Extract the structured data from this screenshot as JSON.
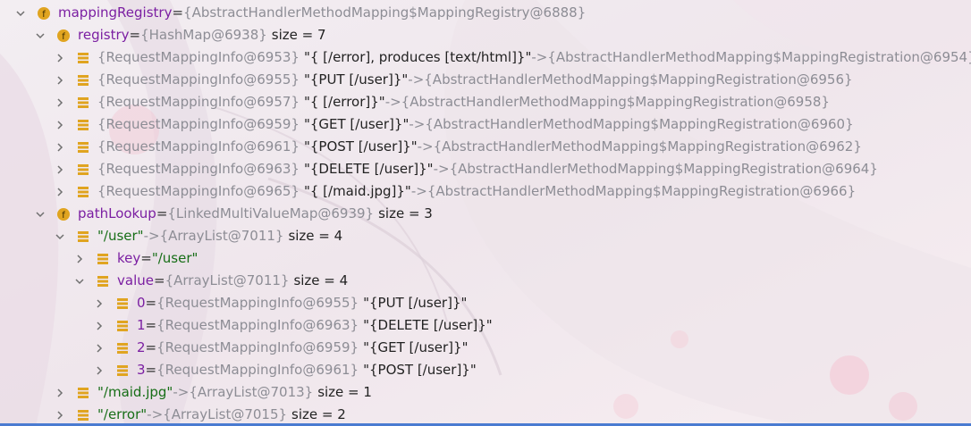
{
  "colors": {
    "field_name": "#7b1fa2",
    "type_text": "#8d8d95",
    "string_value": "#176e17",
    "field_icon": "#e0a420",
    "list_icon": "#e0a420",
    "chevron": "#6f6f6f",
    "accent_bar": "#4a7bd1"
  },
  "rows": [
    {
      "level": 0,
      "expanded": true,
      "icon": "field-icon",
      "icon_letter": "f",
      "name": "mappingRegistry",
      "eq": " = ",
      "type": "{AbstractHandlerMethodMapping$MappingRegistry@6888}",
      "value": "",
      "suffix": ""
    },
    {
      "level": 1,
      "expanded": true,
      "icon": "field-icon",
      "icon_letter": "f",
      "name": "registry",
      "eq": " = ",
      "type": "{HashMap@6938}",
      "value": "",
      "suffix": "size = 7"
    },
    {
      "level": 2,
      "expanded": false,
      "icon": "list-entry-icon",
      "name": "",
      "eq": "",
      "type": "{RequestMappingInfo@6953}",
      "value": "\"{ [/error], produces [text/html]}\"",
      "suffix": "",
      "arrow": " -> ",
      "target": "{AbstractHandlerMethodMapping$MappingRegistration@6954}"
    },
    {
      "level": 2,
      "expanded": false,
      "icon": "list-entry-icon",
      "name": "",
      "eq": "",
      "type": "{RequestMappingInfo@6955}",
      "value": "\"{PUT [/user]}\"",
      "suffix": "",
      "arrow": " -> ",
      "target": "{AbstractHandlerMethodMapping$MappingRegistration@6956}"
    },
    {
      "level": 2,
      "expanded": false,
      "icon": "list-entry-icon",
      "name": "",
      "eq": "",
      "type": "{RequestMappingInfo@6957}",
      "value": "\"{ [/error]}\"",
      "suffix": "",
      "arrow": " -> ",
      "target": "{AbstractHandlerMethodMapping$MappingRegistration@6958}"
    },
    {
      "level": 2,
      "expanded": false,
      "icon": "list-entry-icon",
      "name": "",
      "eq": "",
      "type": "{RequestMappingInfo@6959}",
      "value": "\"{GET [/user]}\"",
      "suffix": "",
      "arrow": " -> ",
      "target": "{AbstractHandlerMethodMapping$MappingRegistration@6960}"
    },
    {
      "level": 2,
      "expanded": false,
      "icon": "list-entry-icon",
      "name": "",
      "eq": "",
      "type": "{RequestMappingInfo@6961}",
      "value": "\"{POST [/user]}\"",
      "suffix": "",
      "arrow": " -> ",
      "target": "{AbstractHandlerMethodMapping$MappingRegistration@6962}"
    },
    {
      "level": 2,
      "expanded": false,
      "icon": "list-entry-icon",
      "name": "",
      "eq": "",
      "type": "{RequestMappingInfo@6963}",
      "value": "\"{DELETE [/user]}\"",
      "suffix": "",
      "arrow": " -> ",
      "target": "{AbstractHandlerMethodMapping$MappingRegistration@6964}"
    },
    {
      "level": 2,
      "expanded": false,
      "icon": "list-entry-icon",
      "name": "",
      "eq": "",
      "type": "{RequestMappingInfo@6965}",
      "value": "\"{ [/maid.jpg]}\"",
      "suffix": "",
      "arrow": " -> ",
      "target": "{AbstractHandlerMethodMapping$MappingRegistration@6966}"
    },
    {
      "level": 1,
      "expanded": true,
      "icon": "field-icon",
      "icon_letter": "f",
      "name": "pathLookup",
      "eq": " = ",
      "type": "{LinkedMultiValueMap@6939}",
      "value": "",
      "suffix": "size = 3"
    },
    {
      "level": 2,
      "expanded": true,
      "icon": "list-entry-icon",
      "name": "",
      "eq": "",
      "key_str": "\"/user\"",
      "arrow": " -> ",
      "type": "{ArrayList@7011}",
      "value": "",
      "suffix": "size = 4"
    },
    {
      "level": 3,
      "expanded": false,
      "icon": "list-entry-icon",
      "name": "key",
      "eq": " = ",
      "type": "",
      "value": "\"/user\"",
      "suffix": ""
    },
    {
      "level": 3,
      "expanded": true,
      "icon": "list-entry-icon",
      "name": "value",
      "eq": " = ",
      "type": "{ArrayList@7011}",
      "value": "",
      "suffix": "size = 4"
    },
    {
      "level": 4,
      "expanded": false,
      "icon": "list-entry-icon",
      "name": "0",
      "eq": " = ",
      "type": "{RequestMappingInfo@6955}",
      "value": "\"{PUT [/user]}\"",
      "suffix": ""
    },
    {
      "level": 4,
      "expanded": false,
      "icon": "list-entry-icon",
      "name": "1",
      "eq": " = ",
      "type": "{RequestMappingInfo@6963}",
      "value": "\"{DELETE [/user]}\"",
      "suffix": ""
    },
    {
      "level": 4,
      "expanded": false,
      "icon": "list-entry-icon",
      "name": "2",
      "eq": " = ",
      "type": "{RequestMappingInfo@6959}",
      "value": "\"{GET [/user]}\"",
      "suffix": ""
    },
    {
      "level": 4,
      "expanded": false,
      "icon": "list-entry-icon",
      "name": "3",
      "eq": " = ",
      "type": "{RequestMappingInfo@6961}",
      "value": "\"{POST [/user]}\"",
      "suffix": ""
    },
    {
      "level": 2,
      "expanded": false,
      "icon": "list-entry-icon",
      "name": "",
      "eq": "",
      "key_str": "\"/maid.jpg\"",
      "arrow": " -> ",
      "type": "{ArrayList@7013}",
      "value": "",
      "suffix": "size = 1"
    },
    {
      "level": 2,
      "expanded": false,
      "icon": "list-entry-icon",
      "name": "",
      "eq": "",
      "key_str": "\"/error\"",
      "arrow": " -> ",
      "type": "{ArrayList@7015}",
      "value": "",
      "suffix": "size = 2"
    }
  ]
}
